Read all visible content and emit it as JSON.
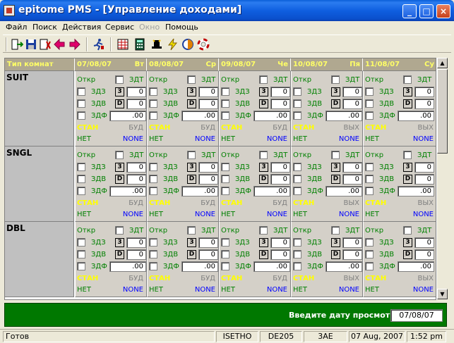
{
  "window": {
    "title": "epitome PMS - [Управление доходами]"
  },
  "titlebar_buttons": {
    "minimize": "_",
    "maximize": "□",
    "close": "×"
  },
  "menu": [
    "Файл",
    "Поиск",
    "Действия",
    "Сервис",
    "Окно",
    "Помощь"
  ],
  "menu_disabled": [
    false,
    false,
    false,
    false,
    true,
    false
  ],
  "toolbar": {
    "icons": [
      "exit-icon",
      "save-icon",
      "close-doc-icon",
      "arrow-left-icon",
      "arrow-right-icon",
      "runner-icon",
      "grid-icon",
      "calculator-icon",
      "hat-icon",
      "lightning-icon",
      "swirl-icon",
      "lifebuoy-icon"
    ]
  },
  "grid": {
    "header_room": "Тип комнат",
    "days": [
      {
        "date": "07/08/07",
        "day": "Вт"
      },
      {
        "date": "08/08/07",
        "day": "Ср"
      },
      {
        "date": "09/08/07",
        "day": "Че"
      },
      {
        "date": "10/08/07",
        "day": "Пя"
      },
      {
        "date": "11/08/07",
        "day": "Су"
      }
    ],
    "labels": {
      "otkr": "Откр",
      "zdt": "ЗДТ",
      "zdz": "ЗДЗ",
      "zdv": "ЗДВ",
      "zdf": "ЗДФ",
      "btn3": "3",
      "btnD": "D",
      "net": "НЕТ",
      "none": "NONE"
    },
    "rooms": [
      {
        "name": "SUIT",
        "cells": [
          {
            "zdz": "0",
            "zdv": "0",
            "zdf": ".00",
            "stat": "СТАН",
            "stat2": "БУД"
          },
          {
            "zdz": "0",
            "zdv": "0",
            "zdf": ".00",
            "stat": "СТАН",
            "stat2": "БУД"
          },
          {
            "zdz": "0",
            "zdv": "0",
            "zdf": ".00",
            "stat": "СТАН",
            "stat2": "БУД"
          },
          {
            "zdz": "0",
            "zdv": "0",
            "zdf": ".00",
            "stat": "СТАН",
            "stat2": "ВЫХ"
          },
          {
            "zdz": "0",
            "zdv": "0",
            "zdf": ".00",
            "stat": "СТАН",
            "stat2": "ВЫХ"
          }
        ]
      },
      {
        "name": "SNGL",
        "cells": [
          {
            "zdz": "0",
            "zdv": "0",
            "zdf": ".00",
            "stat": "СТАН",
            "stat2": "БУД"
          },
          {
            "zdz": "0",
            "zdv": "0",
            "zdf": ".00",
            "stat": "СТАН",
            "stat2": "БУД"
          },
          {
            "zdz": "0",
            "zdv": "0",
            "zdf": ".00",
            "stat": "СТАН",
            "stat2": "БУД"
          },
          {
            "zdz": "0",
            "zdv": "0",
            "zdf": ".00",
            "stat": "СТАН",
            "stat2": "ВЫХ"
          },
          {
            "zdz": "0",
            "zdv": "0",
            "zdf": ".00",
            "stat": "СТАН",
            "stat2": "ВЫХ"
          }
        ]
      },
      {
        "name": "DBL",
        "cells": [
          {
            "zdz": "0",
            "zdv": "0",
            "zdf": ".00",
            "stat": "СТАН",
            "stat2": "БУД"
          },
          {
            "zdz": "0",
            "zdv": "0",
            "zdf": ".00",
            "stat": "СТАН",
            "stat2": "БУД"
          },
          {
            "zdz": "0",
            "zdv": "0",
            "zdf": ".00",
            "stat": "СТАН",
            "stat2": "БУД"
          },
          {
            "zdz": "0",
            "zdv": "0",
            "zdf": ".00",
            "stat": "СТАН",
            "stat2": "ВЫХ"
          },
          {
            "zdz": "0",
            "zdv": "0",
            "zdf": ".00",
            "stat": "СТАН",
            "stat2": "ВЫХ"
          }
        ]
      }
    ]
  },
  "footer": {
    "label": "Введите дату просмотра:",
    "date_value": "07/08/07"
  },
  "statusbar": {
    "status": "Готов",
    "user": "ISETHO",
    "workstation": "DE205",
    "code": "3AE",
    "date": "07 Aug, 2007",
    "time": "1:52 pm"
  },
  "colors": {
    "title_blue": "#0f5fe0",
    "footer_green": "#007800",
    "header_yellow": "#ffff66",
    "label_green": "#008000",
    "none_blue": "#0000ff"
  }
}
